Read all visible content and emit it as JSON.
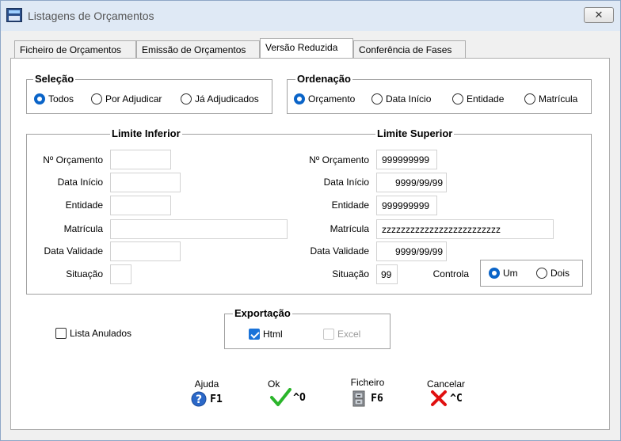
{
  "window": {
    "title": "Listagens de Orçamentos",
    "close_glyph": "✕"
  },
  "tabs": [
    {
      "label": "Ficheiro de Orçamentos"
    },
    {
      "label": "Emissão de Orçamentos"
    },
    {
      "label": "Versão Reduzida",
      "active": true
    },
    {
      "label": "Conferência de Fases"
    }
  ],
  "selecao": {
    "legend": "Seleção",
    "options": [
      "Todos",
      "Por Adjudicar",
      "Já Adjudicados"
    ],
    "selected": "Todos"
  },
  "ordenacao": {
    "legend": "Ordenação",
    "options": [
      "Orçamento",
      "Data Início",
      "Entidade",
      "Matrícula"
    ],
    "selected": "Orçamento"
  },
  "limites": {
    "inferior_title": "Limite Inferior",
    "superior_title": "Limite Superior",
    "labels": {
      "orcamento": "Nº Orçamento",
      "data_inicio": "Data Início",
      "entidade": "Entidade",
      "matricula": "Matrícula",
      "data_validade": "Data Validade",
      "situacao": "Situação"
    },
    "inferior": {
      "orcamento": "",
      "data_inicio": "",
      "entidade": "",
      "matricula": "",
      "data_validade": "",
      "situacao": ""
    },
    "superior": {
      "orcamento": "999999999",
      "data_inicio": "9999/99/99",
      "entidade": "999999999",
      "matricula": "zzzzzzzzzzzzzzzzzzzzzzzzz",
      "data_validade": "9999/99/99",
      "situacao": "99"
    },
    "controla": {
      "label": "Controla",
      "options": [
        "Um",
        "Dois"
      ],
      "selected": "Um"
    }
  },
  "lista_anulados": {
    "label": "Lista Anulados",
    "checked": false
  },
  "exportacao": {
    "legend": "Exportação",
    "html": {
      "label": "Html",
      "checked": true
    },
    "excel": {
      "label": "Excel",
      "checked": false,
      "disabled": true
    }
  },
  "fkeys": [
    {
      "caption": "Ajuda",
      "key": "F1",
      "icon": "help-icon"
    },
    {
      "caption": "Ok",
      "key": "^O",
      "icon": "checkmark-icon"
    },
    {
      "caption": "Ficheiro",
      "key": "F6",
      "icon": "file-cabinet-icon"
    },
    {
      "caption": "Cancelar",
      "key": "^C",
      "icon": "x-cancel-icon"
    }
  ],
  "colors": {
    "accent": "#0a64c8",
    "ok_green": "#2bb52b",
    "cancel_red": "#e01010",
    "help_blue": "#2b68c8"
  }
}
